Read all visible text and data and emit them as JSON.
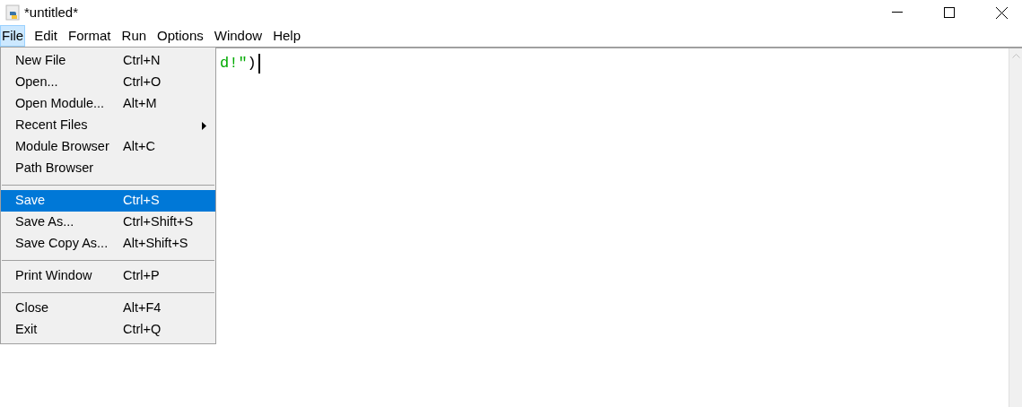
{
  "window": {
    "title": "*untitled*"
  },
  "menubar": [
    {
      "label": "File",
      "selected": true
    },
    {
      "label": "Edit",
      "selected": false
    },
    {
      "label": "Format",
      "selected": false
    },
    {
      "label": "Run",
      "selected": false
    },
    {
      "label": "Options",
      "selected": false
    },
    {
      "label": "Window",
      "selected": false
    },
    {
      "label": "Help",
      "selected": false
    }
  ],
  "editor": {
    "code": [
      {
        "text": "d!\"",
        "kind": "string"
      },
      {
        "text": ")",
        "kind": "plain"
      }
    ]
  },
  "file_menu": [
    {
      "kind": "item",
      "label": "New File",
      "shortcut": "Ctrl+N",
      "selected": false
    },
    {
      "kind": "item",
      "label": "Open...",
      "shortcut": "Ctrl+O",
      "selected": false
    },
    {
      "kind": "item",
      "label": "Open Module...",
      "shortcut": "Alt+M",
      "selected": false
    },
    {
      "kind": "submenu",
      "label": "Recent Files",
      "selected": false
    },
    {
      "kind": "item",
      "label": "Module Browser",
      "shortcut": "Alt+C",
      "selected": false
    },
    {
      "kind": "item",
      "label": "Path Browser",
      "selected": false
    },
    {
      "kind": "separator"
    },
    {
      "kind": "item",
      "label": "Save",
      "shortcut": "Ctrl+S",
      "selected": true
    },
    {
      "kind": "item",
      "label": "Save As...",
      "shortcut": "Ctrl+Shift+S",
      "selected": false
    },
    {
      "kind": "item",
      "label": "Save Copy As...",
      "shortcut": "Alt+Shift+S",
      "selected": false
    },
    {
      "kind": "separator"
    },
    {
      "kind": "item",
      "label": "Print Window",
      "shortcut": "Ctrl+P",
      "selected": false
    },
    {
      "kind": "separator"
    },
    {
      "kind": "item",
      "label": "Close",
      "shortcut": "Alt+F4",
      "selected": false
    },
    {
      "kind": "item",
      "label": "Exit",
      "shortcut": "Ctrl+Q",
      "selected": false
    }
  ]
}
